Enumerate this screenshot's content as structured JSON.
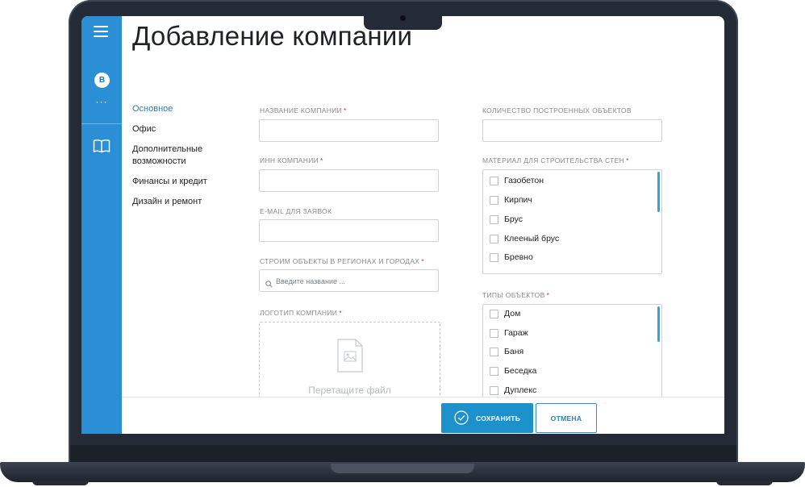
{
  "page": {
    "title": "Добавление компании"
  },
  "rail": {
    "avatar_letter": "B",
    "more": "···"
  },
  "subnav": {
    "items": [
      {
        "label": "Основное",
        "active": true
      },
      {
        "label": "Офис"
      },
      {
        "label": "Дополнительные возможности"
      },
      {
        "label": "Финансы и кредит"
      },
      {
        "label": "Дизайн и ремонт"
      }
    ]
  },
  "form": {
    "required_mark": "*",
    "company_name": {
      "label": "НАЗВАНИЕ КОМПАНИИ",
      "value": ""
    },
    "inn": {
      "label": "ИНН КОМПАНИИ",
      "value": ""
    },
    "email": {
      "label": "E-MAIL ДЛЯ ЗАЯВОК",
      "value": ""
    },
    "regions": {
      "label": "СТРОИМ ОБЪЕКТЫ В РЕГИОНАХ И ГОРОДАХ",
      "placeholder": "Введите название ..."
    },
    "logo": {
      "label": "ЛОГОТИП КОМПАНИИ",
      "drop_text": "Перетащите файл"
    },
    "objects_count": {
      "label": "КОЛИЧЕСТВО ПОСТРОЕННЫХ ОБЪЕКТОВ",
      "value": ""
    },
    "wall_material": {
      "label": "МАТЕРИАЛ ДЛЯ СТРОИТЕЛЬСТВА СТЕН",
      "options": [
        "Газобетон",
        "Кирпич",
        "Брус",
        "Клееный брус",
        "Бревно"
      ]
    },
    "object_types": {
      "label": "ТИПЫ ОБЪЕКТОВ",
      "options": [
        "Дом",
        "Гараж",
        "Баня",
        "Беседка",
        "Дуплекс"
      ]
    }
  },
  "actions": {
    "save_label": "СОХРАНИТЬ",
    "cancel_label": "ОТМЕНА"
  },
  "colors": {
    "accent": "#2a8fd4",
    "save_button": "#1d91cc",
    "required": "#d0312d",
    "frame": "#252b36"
  }
}
